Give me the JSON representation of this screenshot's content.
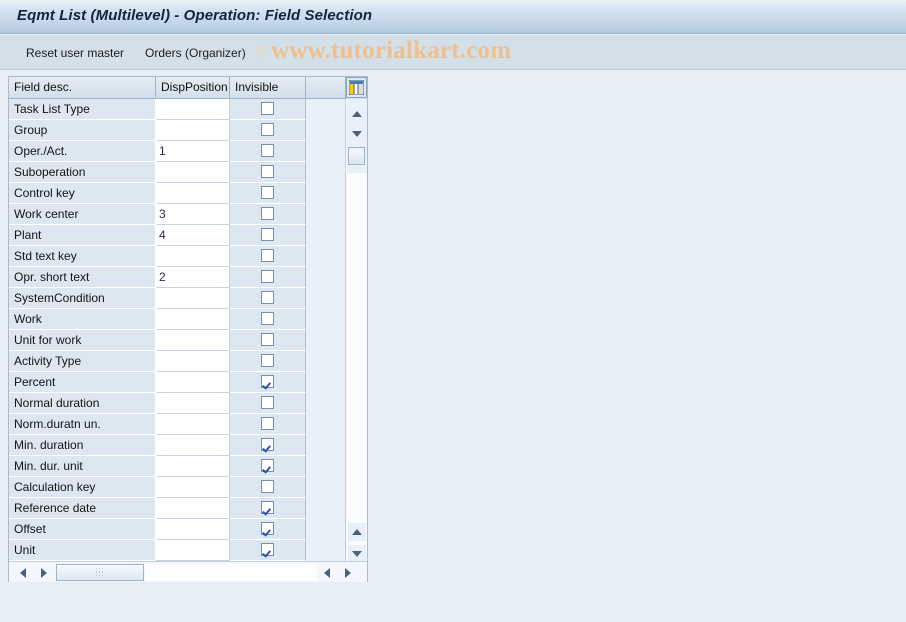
{
  "window": {
    "title": "Eqmt List (Multilevel) - Operation: Field Selection"
  },
  "toolbar": {
    "reset_label": "Reset user master",
    "orders_label": "Orders (Organizer)",
    "watermark_mark": "©",
    "watermark_text": "www.tutorialkart.com"
  },
  "grid": {
    "columns": [
      {
        "key": "field_desc",
        "label": "Field desc."
      },
      {
        "key": "disp_position",
        "label": "DispPosition"
      },
      {
        "key": "invisible",
        "label": "Invisible"
      }
    ],
    "config_icon": "table-columns-icon",
    "rows": [
      {
        "field_desc": "Task List Type",
        "disp_position": "",
        "invisible": false
      },
      {
        "field_desc": "Group",
        "disp_position": "",
        "invisible": false
      },
      {
        "field_desc": "Oper./Act.",
        "disp_position": "1",
        "invisible": false
      },
      {
        "field_desc": "Suboperation",
        "disp_position": "",
        "invisible": false
      },
      {
        "field_desc": "Control key",
        "disp_position": "",
        "invisible": false
      },
      {
        "field_desc": "Work center",
        "disp_position": "3",
        "invisible": false
      },
      {
        "field_desc": "Plant",
        "disp_position": "4",
        "invisible": false
      },
      {
        "field_desc": "Std text key",
        "disp_position": "",
        "invisible": false
      },
      {
        "field_desc": "Opr. short text",
        "disp_position": "2",
        "invisible": false
      },
      {
        "field_desc": "SystemCondition",
        "disp_position": "",
        "invisible": false
      },
      {
        "field_desc": "Work",
        "disp_position": "",
        "invisible": false
      },
      {
        "field_desc": "Unit for work",
        "disp_position": "",
        "invisible": false
      },
      {
        "field_desc": "Activity Type",
        "disp_position": "",
        "invisible": false
      },
      {
        "field_desc": "Percent",
        "disp_position": "",
        "invisible": true
      },
      {
        "field_desc": "Normal duration",
        "disp_position": "",
        "invisible": false
      },
      {
        "field_desc": "Norm.duratn un.",
        "disp_position": "",
        "invisible": false
      },
      {
        "field_desc": "Min. duration",
        "disp_position": "",
        "invisible": true
      },
      {
        "field_desc": "Min. dur. unit",
        "disp_position": "",
        "invisible": true
      },
      {
        "field_desc": "Calculation key",
        "disp_position": "",
        "invisible": false
      },
      {
        "field_desc": "Reference date",
        "disp_position": "",
        "invisible": true
      },
      {
        "field_desc": "Offset",
        "disp_position": "",
        "invisible": true
      },
      {
        "field_desc": "Unit",
        "disp_position": "",
        "invisible": true
      }
    ]
  },
  "colors": {
    "title_bar": "#c3d5e8",
    "toolbar": "#d3dfe9",
    "page_background": "#e8eef5",
    "row_background": "#dde7f1",
    "cell_input": "#ffffff",
    "checkmark": "#2d54a8",
    "watermark": "#f0c08c"
  }
}
